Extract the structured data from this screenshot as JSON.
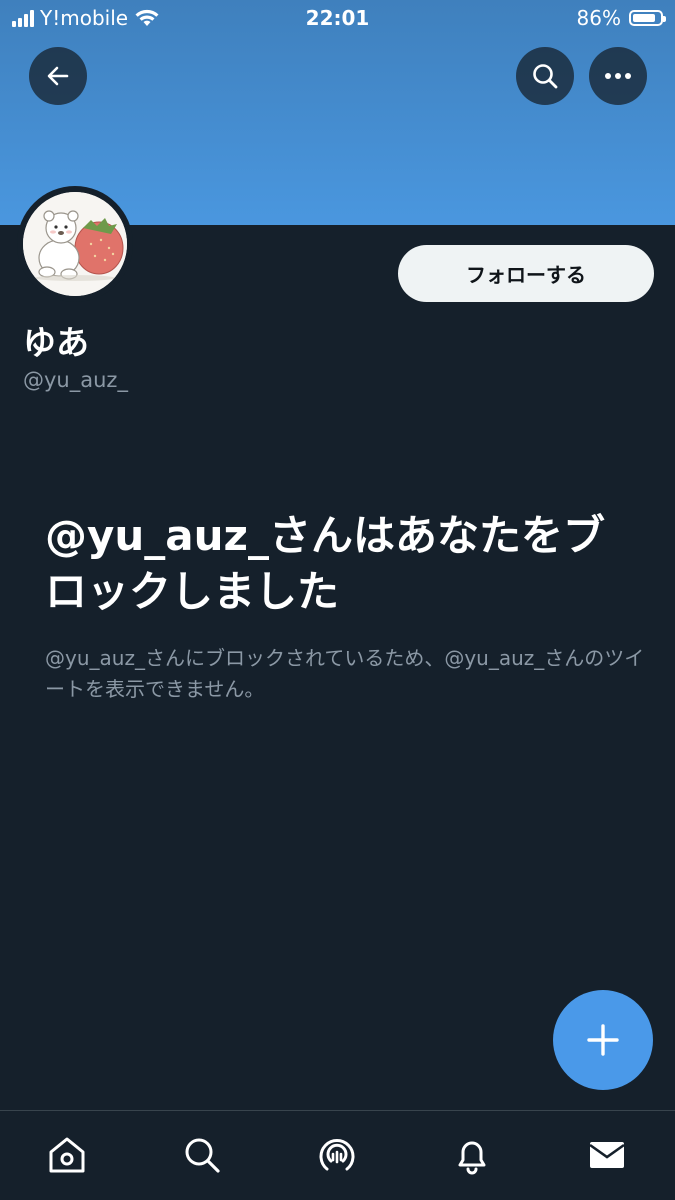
{
  "status_bar": {
    "carrier": "Y!mobile",
    "time": "22:01",
    "battery": "86%",
    "battery_level": 0.86
  },
  "profile": {
    "display_name": "ゆあ",
    "username": "@yu_auz_",
    "follow_label": "フォローする"
  },
  "blocked": {
    "title": "@yu_auz_さんはあなたをブロックしました",
    "description": "@yu_auz_さんにブロックされているため、@yu_auz_さんのツイートを表示できません。"
  },
  "icons": {
    "back": "back-arrow-icon",
    "search": "search-icon",
    "more": "more-dots-icon",
    "compose": "plus-icon",
    "tabs": [
      "home-icon",
      "search-icon",
      "spaces-icon",
      "notifications-bell-icon",
      "messages-envelope-icon"
    ]
  },
  "colors": {
    "background": "#15202b",
    "accent": "#4a99e9",
    "secondary_text": "#8b98a5"
  }
}
